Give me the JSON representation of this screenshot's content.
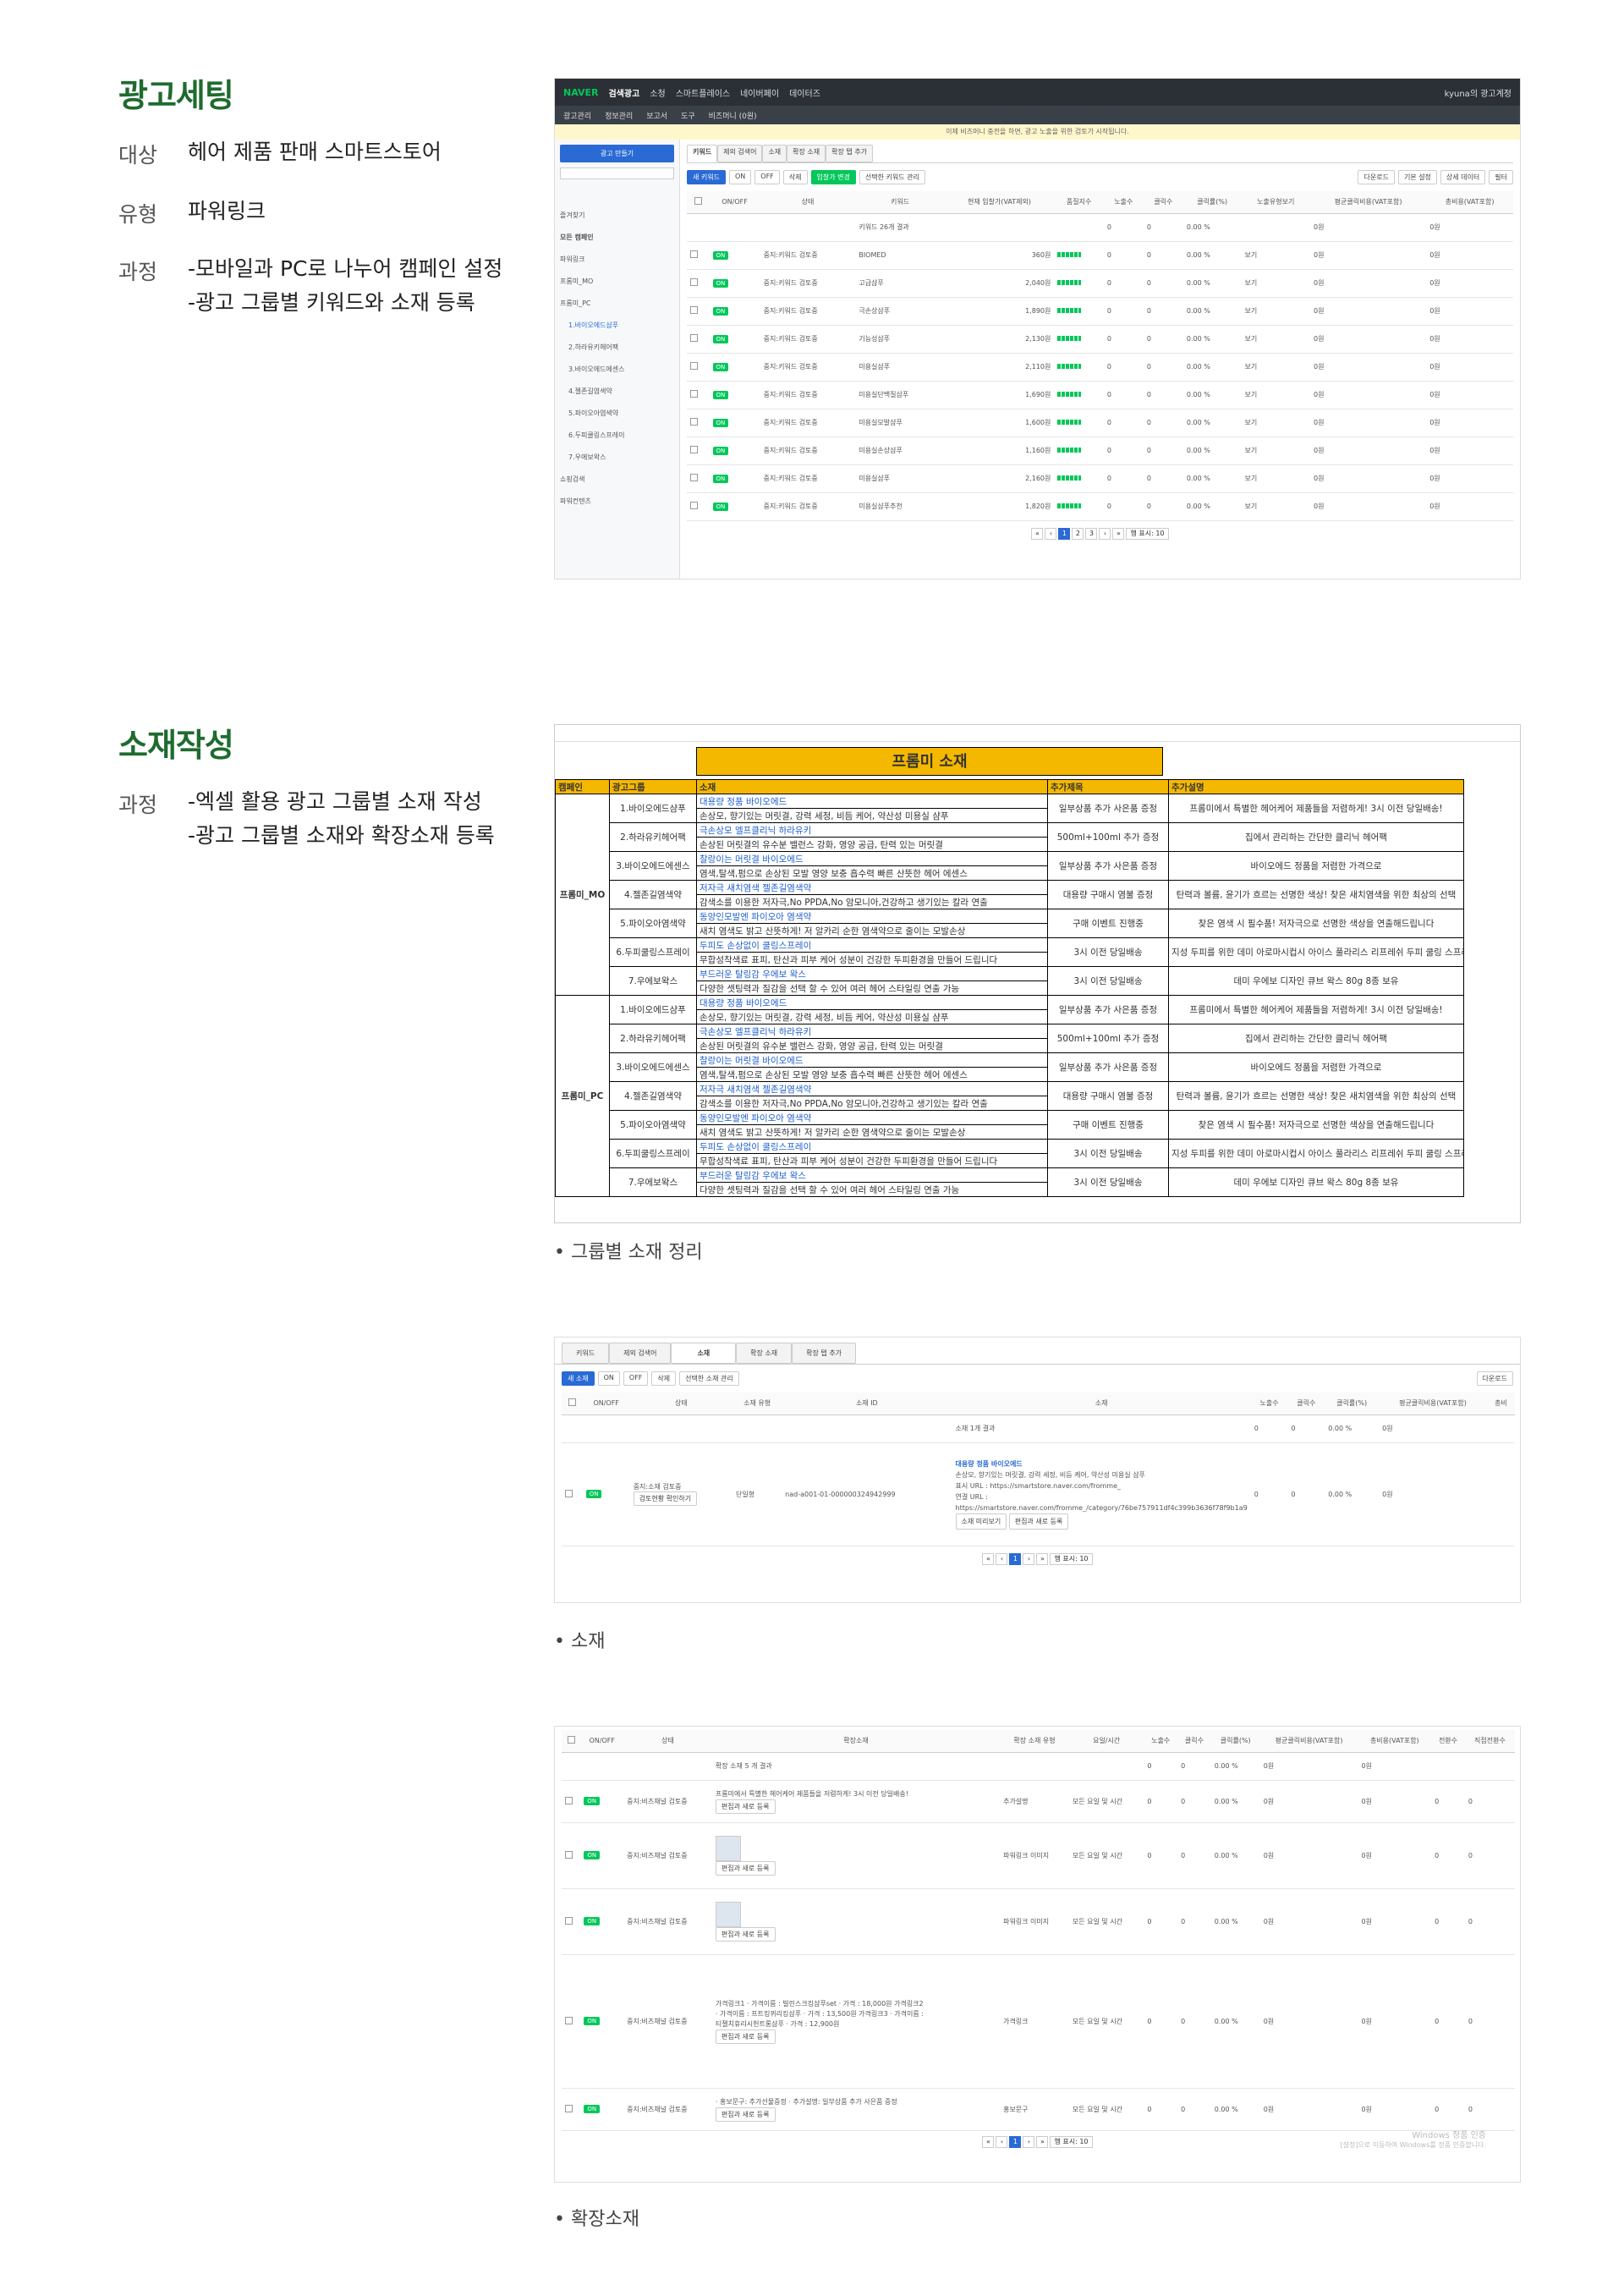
{
  "sec1": {
    "title": "광고세팅",
    "rows": [
      {
        "label": "대상",
        "value": "헤어 제품 판매 스마트스토어"
      },
      {
        "label": "유형",
        "value": "파워링크"
      },
      {
        "label": "과정",
        "value": "-모바일과 PC로 나누어 캠페인 설정",
        "value2": "-광고 그룹별 키워드와 소재 등록"
      }
    ]
  },
  "sec2": {
    "title": "소재작성",
    "label": "과정",
    "v1": "-엑셀 활용 광고 그룹별 소재 작성",
    "v2": "-광고 그룹별 소재와 확장소재 등록"
  },
  "captions": {
    "c1": "• 그룹별 소재 정리",
    "c2": "• 소재",
    "c3": "• 확장소재"
  },
  "naver": {
    "logo": "NAVER",
    "app": "검색광고",
    "menus": [
      "소청",
      "스마트플레이스",
      "네이버페이",
      "데이터즈"
    ],
    "user": "kyuna의 광고계정",
    "submenus": [
      "광고관리",
      "정보관리",
      "보고서",
      "도구",
      "비즈머니 (0원)"
    ],
    "notice": "이제 비즈머니 충전을 하면, 광고 노출을 위한 검토가 시작됩니다.",
    "side": {
      "make_btn": "광고 만들기",
      "items": [
        "즐겨찾기",
        "모든 캠페인",
        "파워링크",
        "프롬미_MO",
        "프롬미_PC",
        "1.바이오에드샴푸",
        "2.하라유키헤어팩",
        "3.바이오에드에센스",
        "4.젤존길염색약",
        "5.파이오아염색약",
        "6.두피쿨링스프레이",
        "7.우에보왁스",
        "쇼핑검색",
        "파워컨텐츠"
      ]
    },
    "tabs": [
      "키워드",
      "제외 검색어",
      "소재",
      "확장 소재",
      "확장 탭 추가"
    ],
    "toolbar": {
      "add": "새 키워드",
      "on": "ON",
      "off": "OFF",
      "del": "삭제",
      "bid": "입찰가 변경",
      "sel": "선택한 키워드 관리",
      "dl": "다운로드",
      "cols": "기본 설정",
      "data": "상세 데이터",
      "filter": "필터"
    },
    "cols": [
      "ON/OFF",
      "상태",
      "키워드",
      "현재 입찰가(VAT제외)",
      "품질지수",
      "노출수",
      "클릭수",
      "클릭률(%)",
      "노출유형보기",
      "평균클릭비용(VAT포함)",
      "총비용(VAT포함)"
    ],
    "summary": {
      "kw": "키워드 26개 결과",
      "imp": "0",
      "clk": "0",
      "ctr": "0.00 %",
      "avg": "0원",
      "cost": "0원"
    },
    "rows": [
      {
        "status": "중지:키워드 검토중",
        "kw": "BIOMED",
        "bid": "360원"
      },
      {
        "status": "중지:키워드 검토중",
        "kw": "고급샴푸",
        "bid": "2,040원"
      },
      {
        "status": "중지:키워드 검토중",
        "kw": "극손상샴푸",
        "bid": "1,890원"
      },
      {
        "status": "중지:키워드 검토중",
        "kw": "기능성샴푸",
        "bid": "2,130원"
      },
      {
        "status": "중지:키워드 검토중",
        "kw": "미용실샴푸",
        "bid": "2,110원"
      },
      {
        "status": "중지:키워드 검토중",
        "kw": "미용실단백질샴푸",
        "bid": "1,690원"
      },
      {
        "status": "중지:키워드 검토중",
        "kw": "미용실모발샴푸",
        "bid": "1,600원"
      },
      {
        "status": "중지:키워드 검토중",
        "kw": "미용실손상샴푸",
        "bid": "1,160원"
      },
      {
        "status": "중지:키워드 검토중",
        "kw": "미용실샴푸",
        "bid": "2,160원"
      },
      {
        "status": "중지:키워드 검토중",
        "kw": "미용실샴푸추천",
        "bid": "1,820원"
      }
    ],
    "row_vals": {
      "imp": "0",
      "clk": "0",
      "ctr": "0.00 %",
      "view": "보기",
      "avg": "0원",
      "cost": "0원"
    },
    "pages": [
      "«",
      "‹",
      "1",
      "2",
      "3",
      "›",
      "»"
    ],
    "per": "행 표시: 10"
  },
  "excel": {
    "title": "프롬미 소재",
    "headers": [
      "캠페인",
      "광고그룹",
      "소재",
      "추가제목",
      "추가설명"
    ],
    "campaigns": [
      "프롬미_MO",
      "프롬미_PC"
    ],
    "groups": [
      {
        "g": "1.바이오에드샴푸",
        "t": "대용량 정품 바이오에드",
        "d": "손상모, 향기있는 머릿결, 강력 세정, 비듬 케어, 약산성 미용실 샴푸",
        "add": "일부상품 추가 사은품 증정",
        "desc": "프롬미에서 특별한 헤어케어 제품들을 저렴하게! 3시 이전 당일배송!"
      },
      {
        "g": "2.하라유키헤어팩",
        "t": "극손상모 엘프클리닉 하라유키",
        "d": "손상된 머릿결의 유수분 밸런스 강화, 영양 공급, 탄력 있는 머릿결",
        "add": "500ml+100ml 추가 증정",
        "desc": "집에서 관리하는 간단한 클리닉 헤어팩"
      },
      {
        "g": "3.바이오에드에센스",
        "t": "찰랑이는 머릿결 바이오에드",
        "d": "염색,탈색,펌으로 손상된 모발 영양 보충 흡수력 빠른 산뜻한 헤어 에센스",
        "add": "일부상품 추가 사은품 증정",
        "desc": "바이오에드 정품을 저렴한 가격으로"
      },
      {
        "g": "4.젤존길염색약",
        "t": "저자극 새치염색 젤존길염색약",
        "d": "감색소를 이용한 저자극,No PPDA,No 암모니아,건강하고 생기있는 칼라 연출",
        "add": "대용량 구매시 염불 증정",
        "desc": "탄력과 볼륨, 윤기가 흐르는 선명한 색상! 찾은 새치염색을 위한 최상의 선택"
      },
      {
        "g": "5.파이오아염색약",
        "t": "동양인모발엔 파이오아 염색약",
        "d": "새치 염색도 밝고 산뜻하게! 저 알카리 순한 염색약으로 줄이는 모발손상",
        "add": "구매 이벤트 진행중",
        "desc": "찾은 염색 시 필수품! 저자극으로 선명한 색상을 연출해드립니다"
      },
      {
        "g": "6.두피쿨링스프레이",
        "t": "두피도 손상없이 쿨링스프레이",
        "d": "무합성착색료 표피, 탄산과 피부 케어 성분이 건강한 두피환경을 만들어 드립니다",
        "add": "3시 이전 당일배송",
        "desc": "지성 두피를 위한 데미 아로마시컵시 아이스 풀라리스 리프레쉬 두피 쿨링 스프레이"
      },
      {
        "g": "7.우에보왁스",
        "t": "부드러운 탈링감 우에보 왁스",
        "d": "다양한 셋팅력과 질감을 선택 할 수 있어 여러 헤어 스타일링 연출 가능",
        "add": "3시 이전 당일배송",
        "desc": "데미 우에보 디자인 큐브 왁스 80g 8종 보유"
      }
    ]
  },
  "creative": {
    "tabs": [
      "키워드",
      "제외 검색어",
      "소재",
      "확장 소재",
      "확장 탭 추가"
    ],
    "add": "새 소재",
    "on": "ON",
    "off": "OFF",
    "del": "삭제",
    "sel": "선택한 소재 관리",
    "dl": "다운로드",
    "cols": [
      "ON/OFF",
      "상태",
      "소재 유형",
      "소재 ID",
      "소재",
      "노출수",
      "클릭수",
      "클릭률(%)",
      "평균클릭비용(VAT포함)",
      "총비"
    ],
    "summary": "소재 1개 결과",
    "status": "중지:소재 검토중",
    "check": "검토현황 확인하기",
    "type": "단일형",
    "id": "nad-a001-01-000000324942999",
    "ad_title": "대용량 정품 바이오에드",
    "ad_desc": "손상모, 향기있는 머릿결, 강력 세정, 비듬 케어, 약산성 미용실 샴푸",
    "url1": "표시 URL : https://smartstore.naver.com/fromme_",
    "url2": "연결 URL : https://smartstore.naver.com/fromme_/category/76be757911df4c399b3636f78f9b1a9",
    "btn1": "소재 미리보기",
    "btn2": "편집과 새로 등록",
    "zero": "0",
    "pct": "0.00 %",
    "won": "0원"
  },
  "ext": {
    "cols": [
      "ON/OFF",
      "상태",
      "확장소재",
      "확장 소재 유형",
      "요일/시간",
      "노출수",
      "클릭수",
      "클릭률(%)",
      "평균클릭비용(VAT포함)",
      "총비용(VAT포함)",
      "전환수",
      "직접전환수"
    ],
    "summary": "확장 소재 5 개 결과",
    "status": "중지:비즈채널 검토중",
    "edit": "편집과 새로 등록",
    "allday": "모든 요일 및 시간",
    "rows": [
      {
        "content": "프롬미에서 특별한 헤어케어 제품들을 저렴하게! 3시 이전 당일배송!",
        "type": "추가설명"
      },
      {
        "content": "",
        "type": "파워링크 이미지"
      },
      {
        "content": "",
        "type": "파워링크 이미지"
      },
      {
        "content": "가격링크1 · 가격이름 : 빌린스크킹샴푸set · 가격 : 18,000원 가격링크2 · 가격이름 : 프트킹퀴리킹샴푸 · 가격 : 13,500원 가격링크3 · 가격이름 : 티젤치휴리시헌트롱샴푸 · 가격 : 12,900원",
        "type": "가격링크"
      },
      {
        "content": "· 홍보문구: 추가선물증정 · 추가설명: 일부상품 추가 사은품 증정",
        "type": "홍보문구"
      }
    ],
    "watermark": "Windows 정품 인증",
    "watermark2": "[설정]으로 이동하여 Windows를 정품 인증합니다."
  }
}
